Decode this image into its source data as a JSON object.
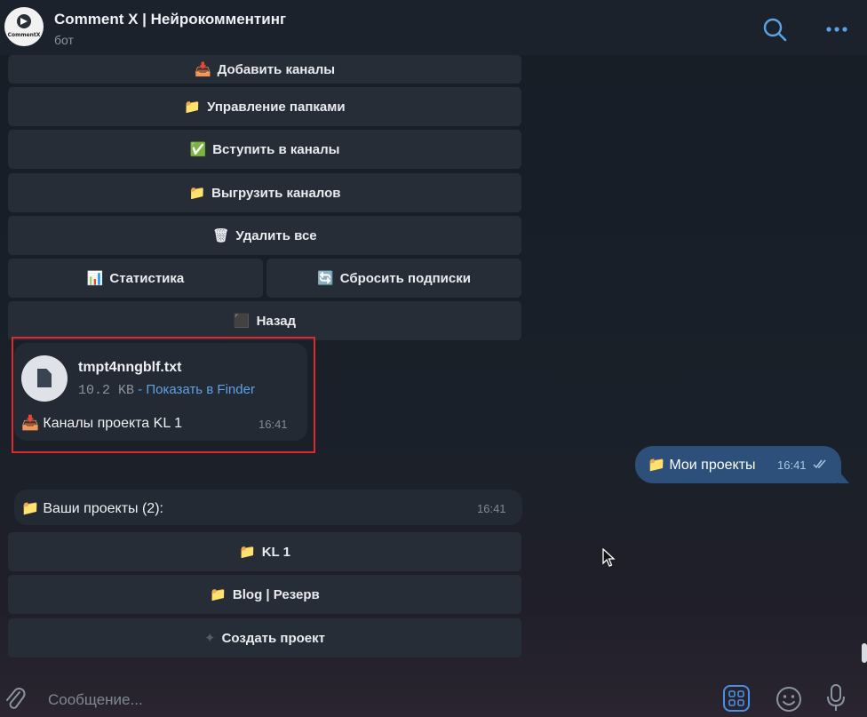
{
  "header": {
    "title": "Comment X | Нейрокомментинг",
    "subtitle": "бот",
    "avatar_text": "CommentX"
  },
  "keyboard_top": [
    {
      "emoji": "📥",
      "label": "Добавить каналы"
    },
    {
      "emoji": "📁",
      "label": "Управление папками"
    },
    {
      "emoji": "✅",
      "label": "Вступить в каналы"
    },
    {
      "emoji": "📁",
      "label": "Выгрузить каналов"
    },
    {
      "emoji": "🗑",
      "label": "Удалить все"
    },
    {
      "emoji": "📊",
      "label": "Статистика"
    },
    {
      "emoji": "🔄",
      "label": "Сбросить подписки"
    },
    {
      "emoji": "⬛",
      "label": "Назад"
    }
  ],
  "file_message": {
    "filename": "tmpt4nngblf.txt",
    "size": "10.2 KB",
    "separator": " - ",
    "link": "Показать в Finder",
    "caption_emoji": "📥",
    "caption": "Каналы проекта KL 1",
    "time": "16:41"
  },
  "outgoing": {
    "emoji": "📁",
    "text": "Мои проекты",
    "time": "16:41"
  },
  "projects_message": {
    "emoji": "📁",
    "text": "Ваши проекты (2):",
    "time": "16:41"
  },
  "keyboard_projects": [
    {
      "emoji": "📁",
      "label": "KL 1"
    },
    {
      "emoji": "📁",
      "label": "Blog | Резерв"
    },
    {
      "emoji": "✦",
      "label": "Создать проект"
    }
  ],
  "composer": {
    "placeholder": "Сообщение..."
  }
}
